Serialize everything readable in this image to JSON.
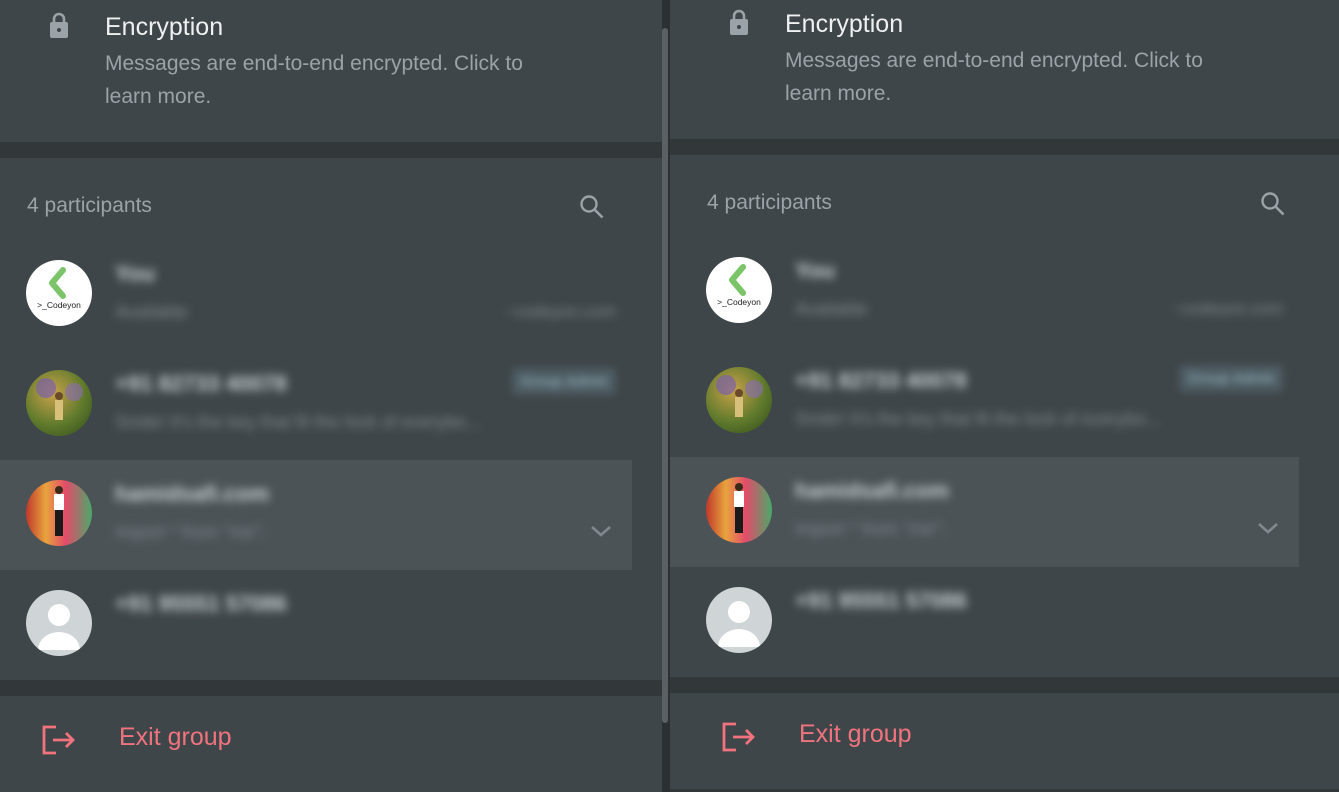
{
  "encryption": {
    "title": "Encryption",
    "description": "Messages are end-to-end encrypted. Click to learn more."
  },
  "participants": {
    "count_label": "4 participants",
    "items": [
      {
        "name": "You",
        "status": "Available",
        "meta": "~codeyon.com",
        "avatar": "codeyon-logo"
      },
      {
        "name": "+91 82733 40078",
        "status": "Smile! It's the key that fit the lock of everybo...",
        "badge": "Group Admin",
        "avatar": "photo-garden"
      },
      {
        "name": "hamidsafi.com",
        "status": "import * from \"me\";",
        "avatar": "photo-stage",
        "hovered": true
      },
      {
        "name": "+91 95551 57086",
        "status": "",
        "avatar": "default-user"
      }
    ]
  },
  "exit": {
    "label": "Exit group"
  },
  "logo_text": ">_Codeyon",
  "colors": {
    "panel": "#3f4649",
    "background": "#32373a",
    "danger": "#f0737e",
    "accent_green": "#7cc46a"
  }
}
